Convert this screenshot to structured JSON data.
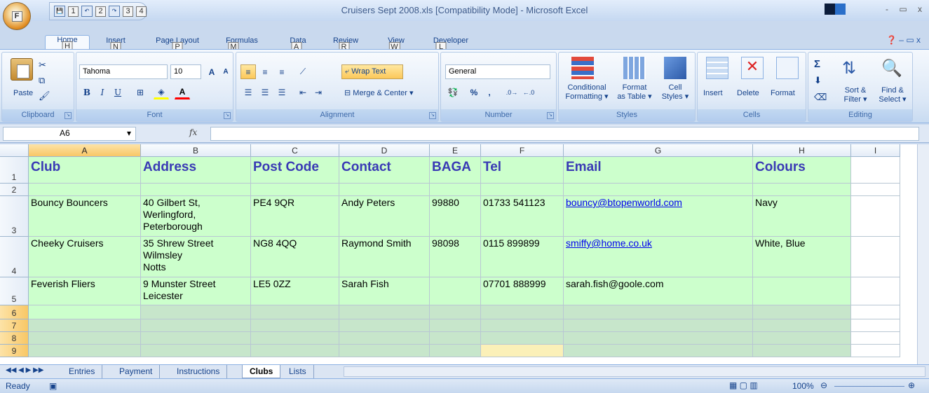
{
  "window": {
    "title": "Cruisers Sept 2008.xls  [Compatibility Mode] - Microsoft Excel",
    "controls": "- ▭ x"
  },
  "office_button": {
    "keytip": "F"
  },
  "qat": {
    "keytips": [
      "1",
      "2",
      "3",
      "4"
    ]
  },
  "ribbon_tabs": [
    {
      "label": "Home",
      "keytip": "H",
      "active": true
    },
    {
      "label": "Insert",
      "keytip": "N"
    },
    {
      "label": "Page Layout",
      "keytip": "P"
    },
    {
      "label": "Formulas",
      "keytip": "M"
    },
    {
      "label": "Data",
      "keytip": "A"
    },
    {
      "label": "Review",
      "keytip": "R"
    },
    {
      "label": "View",
      "keytip": "W"
    },
    {
      "label": "Developer",
      "keytip": "L"
    }
  ],
  "ribbon": {
    "clipboard": {
      "label": "Clipboard",
      "paste": "Paste"
    },
    "font": {
      "label": "Font",
      "font_name": "Tahoma",
      "font_size": "10",
      "bold": "B",
      "italic": "I",
      "underline": "U",
      "grow": "A",
      "shrink": "A"
    },
    "alignment": {
      "label": "Alignment",
      "wrap_text": "Wrap Text",
      "merge_center": "Merge & Center"
    },
    "number": {
      "label": "Number",
      "format": "General",
      "percent": "%",
      "comma": ","
    },
    "styles": {
      "label": "Styles",
      "conditional": "Conditional\nFormatting ▾",
      "format_table": "Format\nas Table ▾",
      "cell_styles": "Cell\nStyles ▾"
    },
    "cells": {
      "label": "Cells",
      "insert": "Insert",
      "delete": "Delete",
      "format": "Format"
    },
    "editing": {
      "label": "Editing",
      "sort_filter": "Sort &\nFilter ▾",
      "find_select": "Find &\nSelect ▾",
      "sigma": "Σ"
    }
  },
  "formula_bar": {
    "name_box": "A6",
    "fx": "fx",
    "value": ""
  },
  "columns": [
    "A",
    "B",
    "C",
    "D",
    "E",
    "F",
    "G",
    "H",
    "I"
  ],
  "selected_column": "A",
  "rows": [
    {
      "n": "1",
      "cells": [
        "Club",
        "Address",
        "Post Code",
        "Contact",
        "BAGA",
        "Tel",
        "Email",
        "Colours",
        ""
      ]
    },
    {
      "n": "2",
      "cells": [
        "",
        "",
        "",
        "",
        "",
        "",
        "",
        "",
        ""
      ]
    },
    {
      "n": "3",
      "cells": [
        "Bouncy Bouncers",
        "40 Gilbert St,\nWerlingford,\nPeterborough",
        "PE4 9QR",
        "Andy Peters",
        "99880",
        " 01733 541123",
        "bouncy@btopenworld.com",
        " Navy",
        ""
      ]
    },
    {
      "n": "4",
      "cells": [
        "Cheeky Cruisers",
        "35 Shrew Street\nWilmsley\nNotts",
        "NG8 4QQ",
        "Raymond Smith",
        "98098",
        "0115 899899",
        "smiffy@home.co.uk",
        "White, Blue",
        ""
      ]
    },
    {
      "n": "5",
      "cells": [
        "Feverish Fliers",
        "9 Munster Street\nLeicester",
        "LE5 0ZZ",
        "Sarah Fish",
        "",
        "07701 888999",
        "sarah.fish@goole.com",
        "",
        ""
      ]
    },
    {
      "n": "6",
      "cells": [
        "",
        "",
        "",
        "",
        "",
        "",
        "",
        "",
        ""
      ]
    },
    {
      "n": "7",
      "cells": [
        "",
        "",
        "",
        "",
        "",
        "",
        "",
        "",
        ""
      ]
    },
    {
      "n": "8",
      "cells": [
        "",
        "",
        "",
        "",
        "",
        "",
        "",
        "",
        ""
      ]
    },
    {
      "n": "9",
      "cells": [
        "",
        "",
        "",
        "",
        "",
        "",
        "",
        "",
        ""
      ]
    }
  ],
  "selected_rows": [
    "6",
    "7",
    "8",
    "9"
  ],
  "sheet_tabs": [
    {
      "label": "Entries"
    },
    {
      "label": "Payment"
    },
    {
      "label": "Instructions"
    },
    {
      "label": "Clubs",
      "active": true
    },
    {
      "label": "Lists"
    }
  ],
  "status": {
    "ready": "Ready",
    "zoom": "100%"
  },
  "colors": {
    "sheet_fill": "#ccffcc",
    "header_text": "#3a3ab5",
    "selection": "#f8c766"
  }
}
